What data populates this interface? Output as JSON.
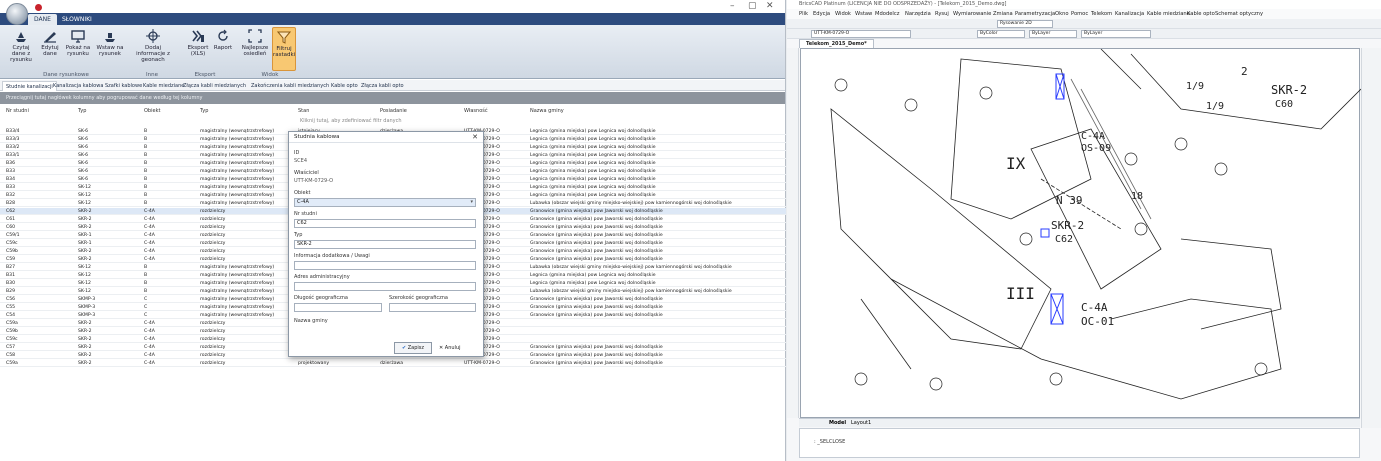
{
  "left_app": {
    "title_controls": [
      "–",
      "▢",
      "✕"
    ],
    "tabs": [
      "DANE",
      "SŁOWNIKI"
    ],
    "ribbon": {
      "buttons": [
        {
          "label": "Czytaj dane z rysunku"
        },
        {
          "label": "Edytuj dane"
        },
        {
          "label": "Pokaż na rysunku"
        },
        {
          "label": "Wstaw na rysunek"
        },
        {
          "label": "Dodaj informacje z geonach"
        },
        {
          "label": "Eksport (XLS)"
        },
        {
          "label": "Raport"
        },
        {
          "label": "Najlepsze osiedleń"
        },
        {
          "label": "Filtruj rastadki"
        }
      ],
      "groups": [
        "Dane rysunkowe",
        "Inne",
        "Eksport",
        "Widok"
      ]
    },
    "subtabs": [
      "Studnie kanalizacji",
      "Kanalizacja kablowa",
      "Szafki kablowe",
      "Kable miedziane",
      "Złącza kabli miedzianych",
      "Zakończenia kabli miedzianych",
      "Kable opto",
      "Złącza kabli opto"
    ],
    "groupbar_text": "Przeciągnij tutaj nagłówek kolumny aby pogrupować dane według tej kolumny",
    "grid": {
      "headers": [
        "Nr studni",
        "Typ",
        "Obiekt",
        "Typ",
        "Stan",
        "Posiadanie",
        "Własność",
        "Nazwa gminy"
      ],
      "empty_text": "Kliknij tutaj, aby zdefiniować filtr danych",
      "rows": [
        [
          "B33/4",
          "SK-6",
          "B",
          "magistralny (wewnątrzstrefowy)",
          "istniejący",
          "dzierżawa",
          "UTT-KM-0729-O",
          "Legnica (gmina miejska) pow Legnica woj dolnośląskie"
        ],
        [
          "B33/3",
          "SK-6",
          "B",
          "magistralny (wewnątrzstrefowy)",
          "",
          "",
          "UTT-KM-0729-O",
          "Legnica (gmina miejska) pow Legnica woj dolnośląskie"
        ],
        [
          "B33/2",
          "SK-6",
          "B",
          "magistralny (wewnątrzstrefowy)",
          "",
          "",
          "UTT-KM-0729-O",
          "Legnica (gmina miejska) pow Legnica woj dolnośląskie"
        ],
        [
          "B33/1",
          "SK-6",
          "B",
          "magistralny (wewnątrzstrefowy)",
          "",
          "",
          "UTT-KM-0729-O",
          "Legnica (gmina miejska) pow Legnica woj dolnośląskie"
        ],
        [
          "B36",
          "SK-6",
          "B",
          "magistralny (wewnątrzstrefowy)",
          "",
          "",
          "UTT-KM-0729-O",
          "Legnica (gmina miejska) pow Legnica woj dolnośląskie"
        ],
        [
          "B33",
          "SK-6",
          "B",
          "magistralny (wewnątrzstrefowy)",
          "",
          "",
          "UTT-KM-0729-O",
          "Legnica (gmina miejska) pow Legnica woj dolnośląskie"
        ],
        [
          "B34",
          "SK-6",
          "B",
          "magistralny (wewnątrzstrefowy)",
          "",
          "",
          "UTT-KM-0729-O",
          "Legnica (gmina miejska) pow Legnica woj dolnośląskie"
        ],
        [
          "B33",
          "SK-12",
          "B",
          "magistralny (wewnątrzstrefowy)",
          "",
          "",
          "UTT-KM-0729-O",
          "Legnica (gmina miejska) pow Legnica woj dolnośląskie"
        ],
        [
          "B32",
          "SK-12",
          "B",
          "magistralny (wewnątrzstrefowy)",
          "",
          "",
          "UTT-KM-0729-O",
          "Legnica (gmina miejska) pow Legnica woj dolnośląskie"
        ],
        [
          "B28",
          "SK-12",
          "B",
          "magistralny (wewnątrzstrefowy)",
          "",
          "",
          "UTT-KM-0729-O",
          "Lubawka (obszar wiejski gminy miejsko-wiejskiej) pow kamiennogórski woj dolnośląskie"
        ],
        [
          "C62",
          "SKR-2",
          "C-4A",
          "rozdzielczy",
          "",
          "",
          "UTT-KM-0729-O",
          "Granowice (gmina wiejska) pow Jaworski woj dolnośląskie"
        ],
        [
          "C61",
          "SKR-2",
          "C-4A",
          "rozdzielczy",
          "",
          "",
          "UTT-KM-0729-O",
          "Granowice (gmina wiejska) pow Jaworski woj dolnośląskie"
        ],
        [
          "C60",
          "SKR-2",
          "C-4A",
          "rozdzielczy",
          "",
          "",
          "UTT-KM-0729-O",
          "Granowice (gmina wiejska) pow Jaworski woj dolnośląskie"
        ],
        [
          "C59/1",
          "SKR-1",
          "C-4A",
          "rozdzielczy",
          "",
          "",
          "UTT-KM-0729-O",
          "Granowice (gmina wiejska) pow Jaworski woj dolnośląskie"
        ],
        [
          "C59c",
          "SKR-1",
          "C-4A",
          "rozdzielczy",
          "",
          "",
          "UTT-KM-0729-O",
          "Granowice (gmina wiejska) pow Jaworski woj dolnośląskie"
        ],
        [
          "C59b",
          "SKR-2",
          "C-4A",
          "rozdzielczy",
          "",
          "",
          "UTT-KM-0729-O",
          "Granowice (gmina wiejska) pow Jaworski woj dolnośląskie"
        ],
        [
          "C59",
          "SKR-2",
          "C-4A",
          "rozdzielczy",
          "",
          "",
          "UTT-KM-0729-O",
          "Granowice (gmina wiejska) pow Jaworski woj dolnośląskie"
        ],
        [
          "B27",
          "SK-12",
          "B",
          "magistralny (wewnątrzstrefowy)",
          "",
          "",
          "UTT-KM-0729-O",
          "Lubawka (obszar wiejski gminy miejsko-wiejskiej) pow kamiennogórski woj dolnośląskie"
        ],
        [
          "B31",
          "SK-12",
          "B",
          "magistralny (wewnątrzstrefowy)",
          "",
          "",
          "UTT-KM-0729-O",
          "Legnica (gmina miejska) pow Legnica woj dolnośląskie"
        ],
        [
          "B30",
          "SK-12",
          "B",
          "magistralny (wewnątrzstrefowy)",
          "",
          "",
          "UTT-KM-0729-O",
          "Legnica (gmina miejska) pow Legnica woj dolnośląskie"
        ],
        [
          "B29",
          "SK-12",
          "B",
          "magistralny (wewnątrzstrefowy)",
          "",
          "",
          "UTT-KM-0729-O",
          "Lubawka (obszar wiejski gminy miejsko-wiejskiej) pow kamiennogórski woj dolnośląskie"
        ],
        [
          "C56",
          "SKMP-3",
          "C",
          "magistralny (wewnątrzstrefowy)",
          "",
          "",
          "UTT-KM-0729-O",
          "Granowice (gmina wiejska) pow Jaworski woj dolnośląskie"
        ],
        [
          "C55",
          "SKMP-3",
          "C",
          "magistralny (wewnątrzstrefowy)",
          "",
          "",
          "UTT-KM-0729-O",
          "Granowice (gmina wiejska) pow Jaworski woj dolnośląskie"
        ],
        [
          "C54",
          "SKMP-3",
          "C",
          "magistralny (wewnątrzstrefowy)",
          "",
          "",
          "UTT-KM-0729-O",
          "Granowice (gmina wiejska) pow Jaworski woj dolnośląskie"
        ],
        [
          "C59a",
          "SKR-2",
          "C-4A",
          "rozdzielczy",
          "",
          "",
          "UTT-KM-0729-O",
          ""
        ],
        [
          "C59b",
          "SKR-2",
          "C-4A",
          "rozdzielczy",
          "",
          "",
          "UTT-KM-0729-O",
          ""
        ],
        [
          "C59c",
          "SKR-2",
          "C-4A",
          "rozdzielczy",
          "",
          "",
          "UTT-KM-0729-O",
          ""
        ],
        [
          "C57",
          "SKR-2",
          "C-4A",
          "rozdzielczy",
          "projektowany",
          "dzierżawa",
          "UTT-KM-0729-O",
          "Granowice (gmina wiejska) pow Jaworski woj dolnośląskie"
        ],
        [
          "C58",
          "SKR-2",
          "C-4A",
          "rozdzielczy",
          "projektowany",
          "dzierżawa",
          "UTT-KM-0729-O",
          "Granowice (gmina wiejska) pow Jaworski woj dolnośląskie"
        ],
        [
          "C59a",
          "SKR-2",
          "C-4A",
          "rozdzielczy",
          "projektowany",
          "dzierżawa",
          "UTT-KM-0729-O",
          "Granowice (gmina wiejska) pow Jaworski woj dolnośląskie"
        ]
      ]
    },
    "dialog": {
      "title": "Studnia kablowa",
      "id_label": "ID",
      "id_value": "SCE4",
      "owner_label": "Właściciel",
      "owner_value": "UTT-KM-0729-O",
      "object_label": "Obiekt",
      "object_value": "C-4A",
      "number_label": "Nr studni",
      "number_value": "C62",
      "type_label": "Typ",
      "type_value": "SKR-2",
      "info_label": "Informacja dodatkowa / Uwagi",
      "info_value": "",
      "address_label": "Adres administracyjny",
      "address_value": "",
      "lon_label": "Długość geograficzna",
      "lat_label": "Szerokość geograficzna",
      "gmina_label": "Nazwa gminy",
      "ok_label": "Zapisz",
      "cancel_label": "Anuluj"
    }
  },
  "right_app": {
    "title": "BricsCAD Platinum (LICENCJA NIE DO ODSPRZEDAŻY) - [Telekom_2015_Demo.dwg]",
    "menu": [
      "Plik",
      "Edycja",
      "Widok",
      "Wstaw",
      "Mdodelcz",
      "Narzędzia",
      "Rysuj",
      "Wymiarowanie",
      "Zmiana",
      "Parametryzacja",
      "Okno",
      "Pomoc",
      "Telekom",
      "Kanalizacja",
      "Kable miedziane",
      "Kable opto",
      "Schemat optyczny"
    ],
    "layer_value": "UTT-KM-0729-O",
    "linetype_value": "ByLayer",
    "lineweight_value": "ByLayer",
    "color_value": "ByColor",
    "style_value": "Rysowanie 2D",
    "document_tab": "Telekom_2015_Demo*",
    "model_tabs": [
      "Model",
      "Layout1"
    ],
    "command_text": ": _SELCLOSE",
    "drawing_texts": [
      "SKR-2",
      "C60",
      "1/9",
      "SKR-2",
      "C62",
      "C-4A",
      "OS-09",
      "C-4A",
      "OC-01",
      "IX",
      "III",
      "N 39",
      "2",
      "18",
      "1/9"
    ]
  }
}
